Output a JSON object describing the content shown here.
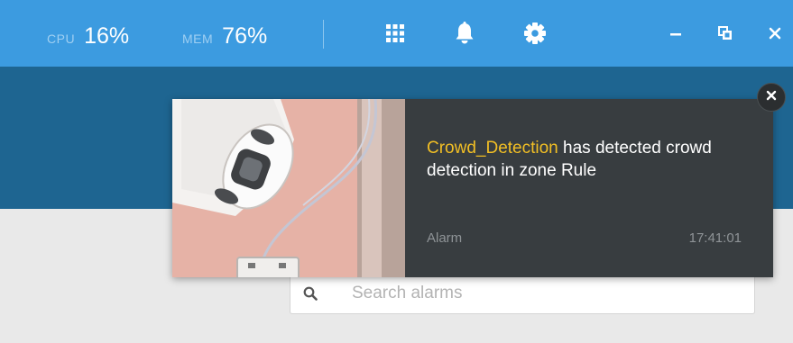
{
  "topbar": {
    "cpu_label": "CPU",
    "cpu_value": "16%",
    "mem_label": "MEM",
    "mem_value": "76%",
    "icons": [
      "apps-grid-icon",
      "bell-icon",
      "gear-icon",
      "minimize-icon",
      "restore-icon",
      "close-icon"
    ]
  },
  "notification": {
    "source": "Crowd_Detection",
    "message": " has detected crowd detection in zone Rule",
    "type": "Alarm",
    "time": "17:41:01"
  },
  "search": {
    "placeholder": "Search alarms"
  },
  "colors": {
    "topbar": "#3c9be0",
    "subheader": "#1e6591",
    "notification_bg": "#383d40",
    "highlight": "#f2bf24",
    "page_bg": "#e9e9e9"
  }
}
